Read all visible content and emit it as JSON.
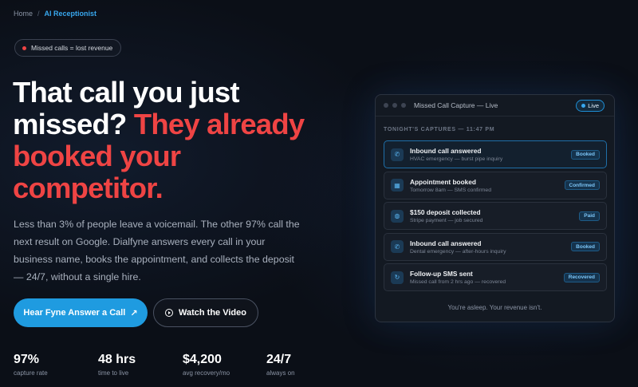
{
  "breadcrumb": {
    "home": "Home",
    "sep": "/",
    "current": "AI Receptionist"
  },
  "pill": {
    "text": "Missed calls = lost revenue"
  },
  "headline": {
    "line1": "That call you just",
    "line2a": "missed?",
    "line2b": "They already",
    "line3": "booked your",
    "line4": "competitor."
  },
  "subtext": "Less than 3% of people leave a voicemail. The other 97% call the next result on Google. Dialfyne answers every call in your business name, books the appointment, and collects the deposit — 24/7, without a single hire.",
  "buttons": {
    "primary": "Hear Fyne Answer a Call",
    "primary_icon": "↗",
    "secondary": "Watch the Video"
  },
  "stats": [
    {
      "value": "97%",
      "label": "capture rate"
    },
    {
      "value": "48 hrs",
      "label": "time to live"
    },
    {
      "value": "$4,200",
      "label": "avg recovery/mo"
    },
    {
      "value": "24/7",
      "label": "always on"
    }
  ],
  "panel": {
    "title": "Missed Call Capture — Live",
    "live_badge": "Live",
    "section_heading": "TONIGHT'S CAPTURES — 11:47 PM",
    "items": [
      {
        "icon": "✆",
        "icon_name": "phone-icon",
        "title": "Inbound call answered",
        "sub": "HVAC emergency — burst pipe inquiry",
        "badge": "Booked"
      },
      {
        "icon": "▦",
        "icon_name": "calendar-icon",
        "title": "Appointment booked",
        "sub": "Tomorrow 8am — SMS confirmed",
        "badge": "Confirmed"
      },
      {
        "icon": "◍",
        "icon_name": "deposit-icon",
        "title": "$150 deposit collected",
        "sub": "Stripe payment — job secured",
        "badge": "Paid"
      },
      {
        "icon": "✆",
        "icon_name": "phone-icon",
        "title": "Inbound call answered",
        "sub": "Dental emergency — after-hours inquiry",
        "badge": "Booked"
      },
      {
        "icon": "↻",
        "icon_name": "refresh-icon",
        "title": "Follow-up SMS sent",
        "sub": "Missed call from 2 hrs ago — recovered",
        "badge": "Recovered"
      }
    ],
    "footer": "You're asleep. Your revenue isn't."
  },
  "colors": {
    "accent": "#1f9be0",
    "red": "#ef4444",
    "background": "#0b0f17"
  }
}
